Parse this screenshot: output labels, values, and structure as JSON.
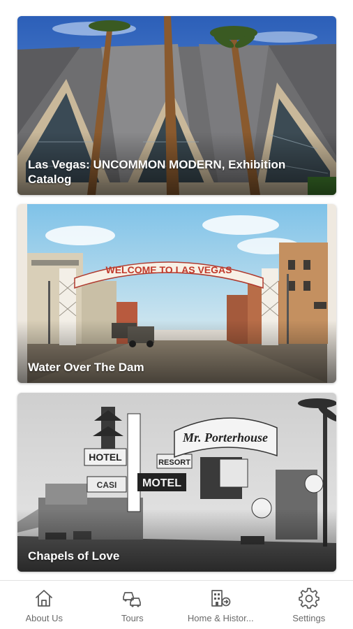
{
  "cards": [
    {
      "title": "Las Vegas: UNCOMMON MODERN, Exhibition Catalog"
    },
    {
      "title": "Water Over The Dam",
      "image_text": "WELCOME TO LAS VEGAS"
    },
    {
      "title": "Chapels of Love",
      "image_text": "Mr. Porterhouse"
    }
  ],
  "tabbar": {
    "items": [
      {
        "label": "About Us",
        "icon": "home-icon"
      },
      {
        "label": "Tours",
        "icon": "cars-icon"
      },
      {
        "label": "Home & Histor...",
        "icon": "building-arrow-icon"
      },
      {
        "label": "Settings",
        "icon": "gear-icon"
      }
    ]
  },
  "colors": {
    "tab_icon": "#5a5a5a",
    "tab_label": "#6b6b6b",
    "card_title": "#ffffff"
  }
}
